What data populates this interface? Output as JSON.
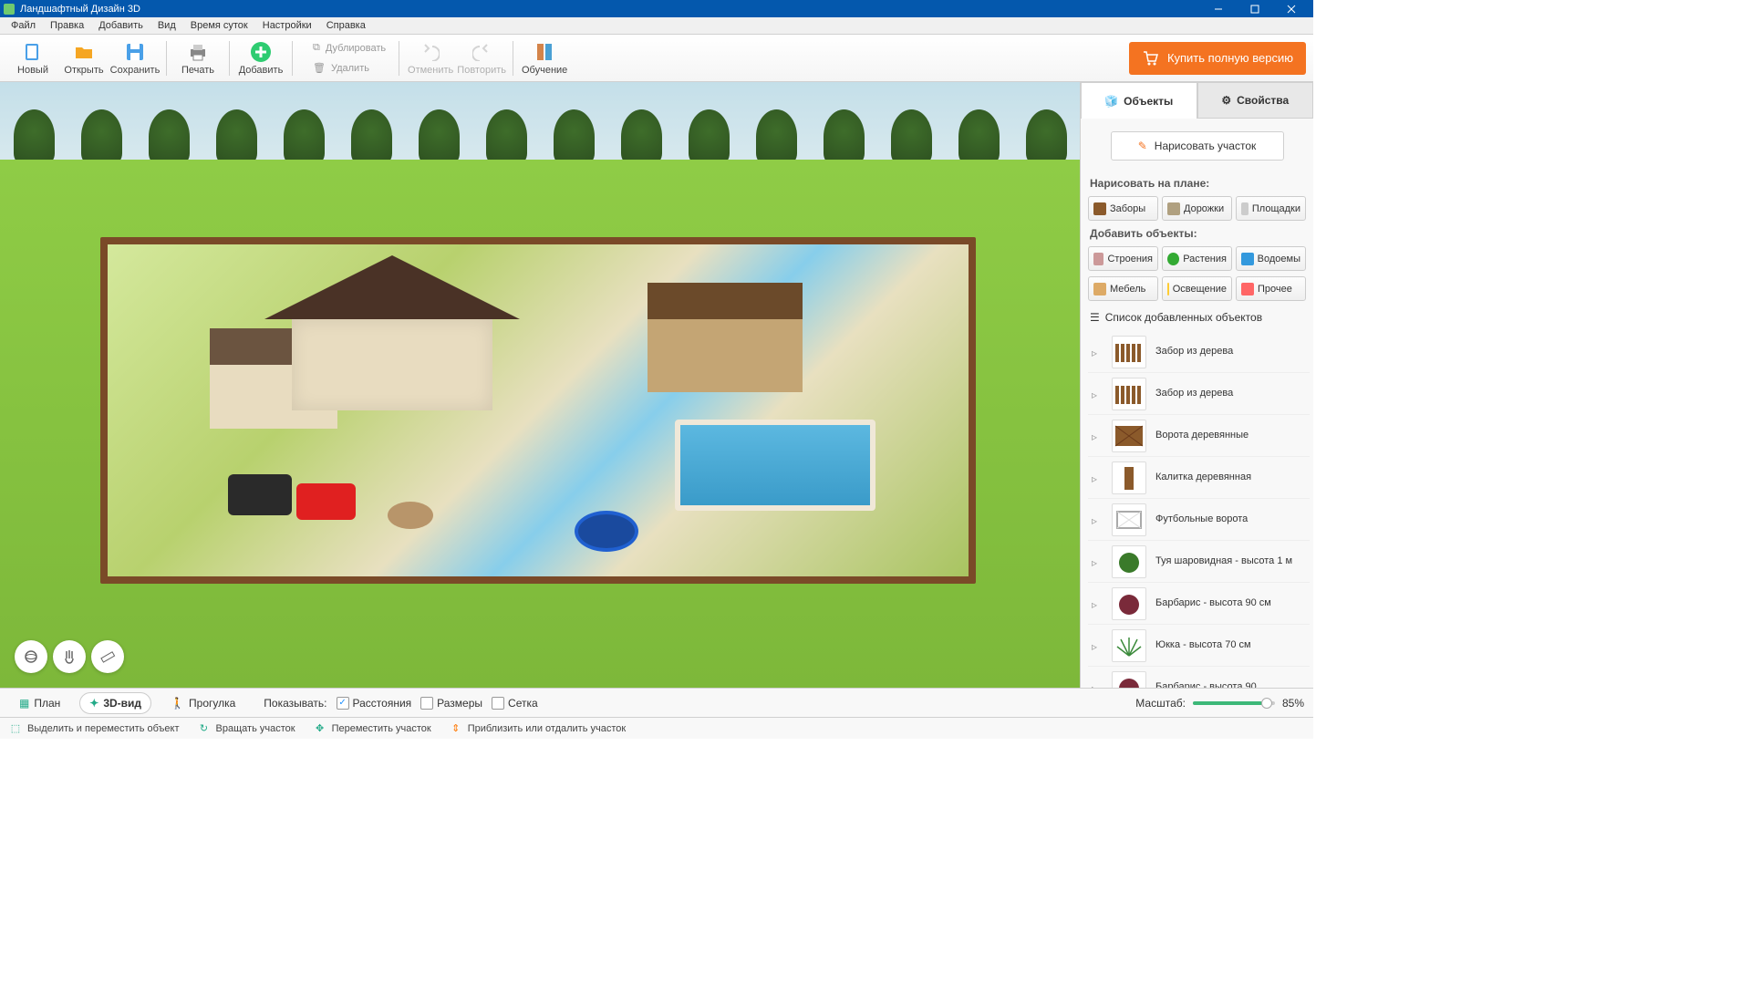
{
  "app_title": "Ландшафтный Дизайн 3D",
  "menu": [
    "Файл",
    "Правка",
    "Добавить",
    "Вид",
    "Время суток",
    "Настройки",
    "Справка"
  ],
  "toolbar": {
    "new": "Новый",
    "open": "Открыть",
    "save": "Сохранить",
    "print": "Печать",
    "add": "Добавить",
    "duplicate": "Дублировать",
    "delete": "Удалить",
    "undo": "Отменить",
    "redo": "Повторить",
    "learn": "Обучение"
  },
  "buy_label": "Купить полную версию",
  "side": {
    "tab_objects": "Объекты",
    "tab_props": "Свойства",
    "draw_plot": "Нарисовать участок",
    "draw_title": "Нарисовать на плане:",
    "fences": "Заборы",
    "paths": "Дорожки",
    "areas": "Площадки",
    "add_title": "Добавить объекты:",
    "buildings": "Строения",
    "plants": "Растения",
    "water": "Водоемы",
    "furniture": "Мебель",
    "lighting": "Освещение",
    "other": "Прочее",
    "list_title": "Список добавленных объектов"
  },
  "objects": [
    {
      "name": "Забор из дерева",
      "thumb": "fence"
    },
    {
      "name": "Забор из дерева",
      "thumb": "fence"
    },
    {
      "name": "Ворота деревянные",
      "thumb": "gate"
    },
    {
      "name": "Калитка деревянная",
      "thumb": "door"
    },
    {
      "name": "Футбольные ворота",
      "thumb": "goal"
    },
    {
      "name": "Туя шаровидная - высота 1 м",
      "thumb": "bush-green"
    },
    {
      "name": "Барбарис - высота 90 см",
      "thumb": "bush-red"
    },
    {
      "name": "Юкка - высота 70 см",
      "thumb": "yucca"
    },
    {
      "name": "Барбарис - высота 90",
      "thumb": "bush-red"
    }
  ],
  "bottom": {
    "plan": "План",
    "view3d": "3D-вид",
    "walk": "Прогулка",
    "show": "Показывать:",
    "distances": "Расстояния",
    "sizes": "Размеры",
    "grid": "Сетка",
    "scale": "Масштаб:",
    "scale_val": "85%"
  },
  "status": {
    "select": "Выделить и переместить объект",
    "rotate": "Вращать участок",
    "move": "Переместить участок",
    "zoom": "Приблизить или отдалить участок"
  }
}
